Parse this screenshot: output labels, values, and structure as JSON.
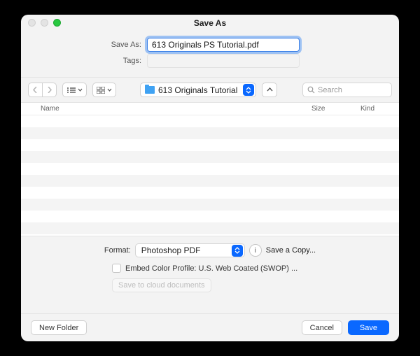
{
  "window": {
    "title": "Save As"
  },
  "form": {
    "saveAsLabel": "Save As:",
    "filename": "613 Originals PS Tutorial.pdf",
    "tagsLabel": "Tags:",
    "tagsValue": ""
  },
  "toolbar": {
    "folder": "613 Originals Tutorial",
    "searchPlaceholder": "Search"
  },
  "list": {
    "columns": {
      "name": "Name",
      "size": "Size",
      "kind": "Kind"
    },
    "rows": []
  },
  "format": {
    "label": "Format:",
    "value": "Photoshop PDF",
    "saveCopy": "Save a Copy...",
    "embedLabel": "Embed Color Profile:  U.S. Web Coated (SWOP) ...",
    "cloud": "Save to cloud documents"
  },
  "footer": {
    "newFolder": "New Folder",
    "cancel": "Cancel",
    "save": "Save"
  }
}
